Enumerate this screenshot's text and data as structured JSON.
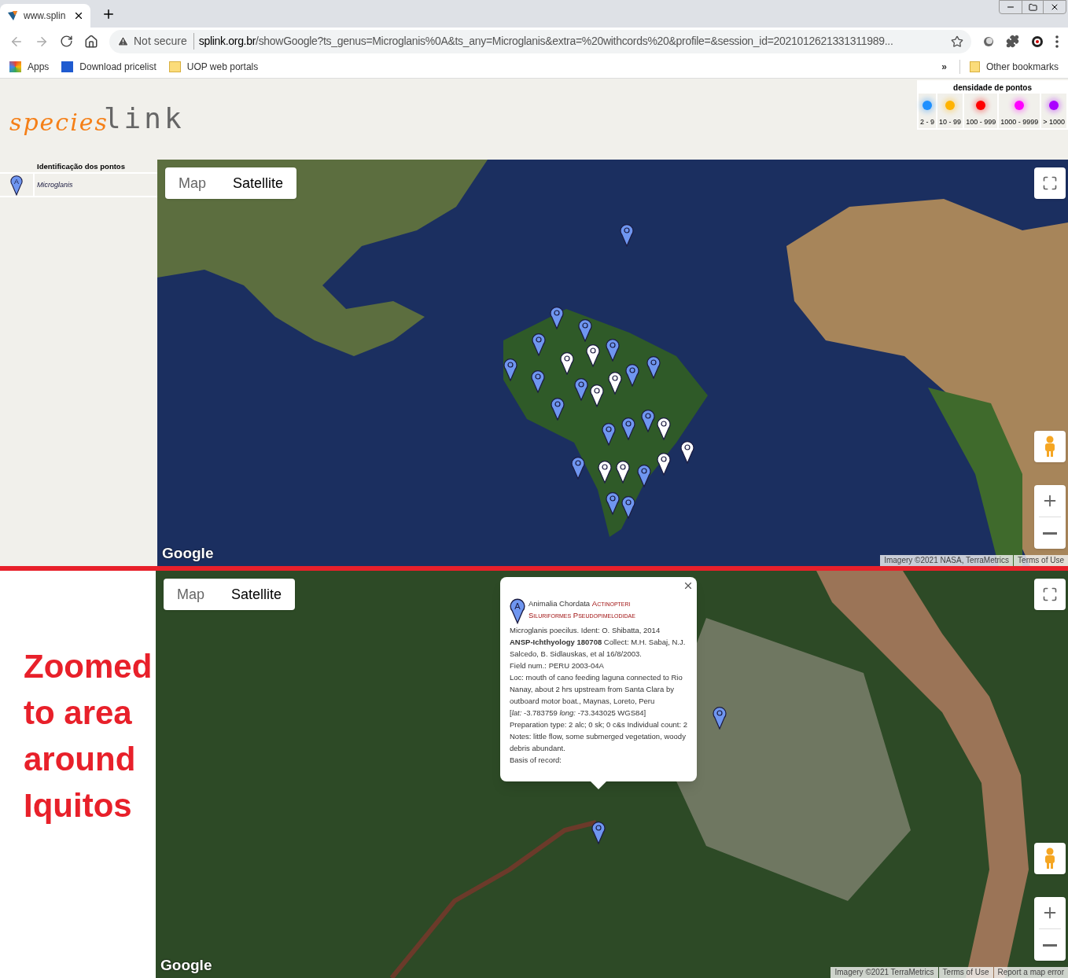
{
  "browser": {
    "tab": {
      "title": "www.splin"
    },
    "security": "Not secure",
    "url_host": "splink.org.br",
    "url_path": "/showGoogle?ts_genus=Microglanis%0A&ts_any=Microglanis&extra=%20withcords%20&profile=&session_id=2021012621331311989...",
    "bookmarks": [
      "Apps",
      "Download pricelist",
      "UOP web portals"
    ],
    "more": "»",
    "other_bookmarks": "Other bookmarks"
  },
  "logo": {
    "part_1": "species",
    "part_2": "link"
  },
  "legend": {
    "title": "densidade de pontos",
    "items": [
      {
        "label": "2 - 9",
        "color": "#1e90ff"
      },
      {
        "label": "10 - 99",
        "color": "#ffb300"
      },
      {
        "label": "100 - 999",
        "color": "#ff0000"
      },
      {
        "label": "1000 - 9999",
        "color": "#ff00ff"
      },
      {
        "label": "> 1000",
        "color": "#aa00ff"
      }
    ]
  },
  "points_panel": {
    "title": "Identificação dos pontos",
    "items": [
      {
        "marker_letter": "A",
        "name": "Microglanis"
      }
    ]
  },
  "caption": [
    "Zoomed",
    "to area",
    "around",
    "Iquitos"
  ],
  "maps": [
    {
      "kind": "world",
      "map_types": [
        {
          "label": "Map",
          "selected": false
        },
        {
          "label": "Satellite",
          "selected": true
        }
      ],
      "logo": "Google",
      "attribution": [
        "Imagery ©2021 NASA, TerraMetrics",
        "Terms of Use"
      ]
    },
    {
      "kind": "local",
      "map_types": [
        {
          "label": "Map",
          "selected": false
        },
        {
          "label": "Satellite",
          "selected": true
        }
      ],
      "logo": "Google",
      "attribution": [
        "Imagery ©2021 TerraMetrics",
        "Terms of Use",
        "Report a map error"
      ],
      "popup": {
        "marker_letter": "A",
        "taxon": "Animalia Chordata",
        "class": "Actinopteri",
        "order_family": "Siluriformes Pseudopimelodidae",
        "lines": [
          "Microglanis poecilus. Ident: O. Shibatta, 2014",
          "**ANSP-Ichthyology 180708** Collect: M.H. Sabaj, N.J. Salcedo, B. Sidlauskas, et al 16/8/2003.",
          "Field num.: PERU 2003-04A",
          "Loc: mouth of cano feeding laguna connected to Rio Nanay, about 2 hrs upstream from Santa Clara by outboard motor boat., Maynas, Loreto, Peru",
          "[*lat:* -3.783759 *long:* -73.343025 WGS84]",
          "Preparation type: 2 alc; 0 sk; 0 c&s Individual count: 2",
          "Notes: little flow, some submerged vegetation, woody debris abundant.",
          "Basis of record:"
        ]
      }
    }
  ]
}
